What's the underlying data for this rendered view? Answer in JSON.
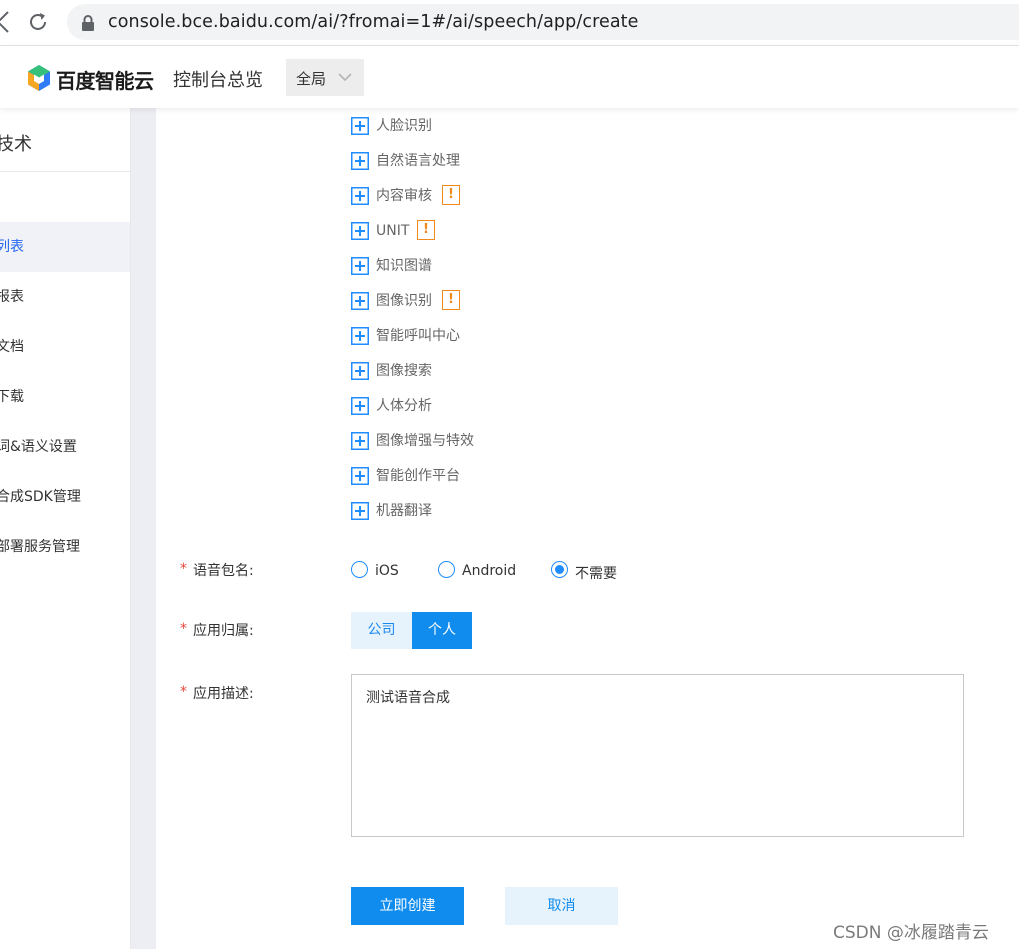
{
  "browser": {
    "url": "console.bce.baidu.com/ai/?fromai=1#/ai/speech/app/create"
  },
  "header": {
    "logo_text": "百度智能云",
    "console_link": "控制台总览",
    "region_label": "全局"
  },
  "sidebar": {
    "title": "技术",
    "items": [
      {
        "label": "列表",
        "active": true
      },
      {
        "label": "报表",
        "active": false
      },
      {
        "label": "文档",
        "active": false
      },
      {
        "label": "下载",
        "active": false
      },
      {
        "label": "词&语义设置",
        "active": false
      },
      {
        "label": "合成SDK管理",
        "active": false
      },
      {
        "label": "部署服务管理",
        "active": false
      }
    ]
  },
  "products": [
    {
      "label": "人脸识别",
      "warning": false
    },
    {
      "label": "自然语言处理",
      "warning": false
    },
    {
      "label": "内容审核",
      "warning": true
    },
    {
      "label": "UNIT",
      "warning": true
    },
    {
      "label": "知识图谱",
      "warning": false
    },
    {
      "label": "图像识别",
      "warning": true
    },
    {
      "label": "智能呼叫中心",
      "warning": false
    },
    {
      "label": "图像搜索",
      "warning": false
    },
    {
      "label": "人体分析",
      "warning": false
    },
    {
      "label": "图像增强与特效",
      "warning": false
    },
    {
      "label": "智能创作平台",
      "warning": false
    },
    {
      "label": "机器翻译",
      "warning": false
    }
  ],
  "warning_glyph": "!",
  "form": {
    "required_mark": "*",
    "package_label": "语音包名:",
    "package_options": [
      {
        "label": "iOS",
        "checked": false
      },
      {
        "label": "Android",
        "checked": false
      },
      {
        "label": "不需要",
        "checked": true
      }
    ],
    "ownership_label": "应用归属:",
    "ownership_options": {
      "company": "公司",
      "personal": "个人"
    },
    "ownership_selected": "个人",
    "description_label": "应用描述:",
    "description_value": "测试语音合成"
  },
  "actions": {
    "create": "立即创建",
    "cancel": "取消"
  },
  "watermark": "CSDN @冰履踏青云",
  "colors": {
    "primary": "#108cee",
    "warning": "#f08a1c",
    "required": "#e8473c",
    "plus_icon": "#1f8cff"
  }
}
